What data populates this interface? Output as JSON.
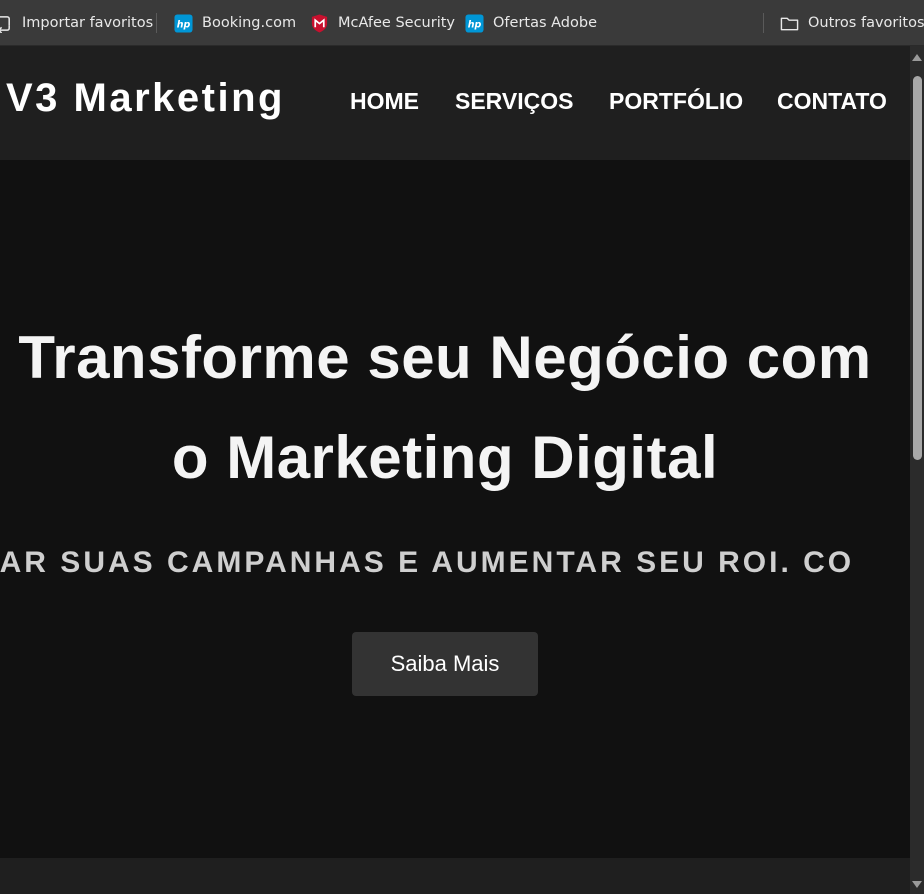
{
  "bookmarks": {
    "import": {
      "label": "Importar favoritos",
      "icon": "import-icon"
    },
    "booking": {
      "label": "Booking.com",
      "icon": "hp-icon"
    },
    "mcafee": {
      "label": "McAfee Security",
      "icon": "mcafee-icon"
    },
    "adobe": {
      "label": "Ofertas Adobe",
      "icon": "hp-icon"
    },
    "others": {
      "label": "Outros favoritos",
      "icon": "folder-icon"
    }
  },
  "site": {
    "logo": "V3 Marketing",
    "nav": {
      "home": "HOME",
      "services": "SERVIÇOS",
      "portfolio": "PORTFÓLIO",
      "contact": "CONTATO"
    },
    "hero": {
      "title_line1": "Transforme seu Negócio com",
      "title_line2": "o Marketing Digital",
      "marquee": "OTIMIZAR SUAS CAMPANHAS E AUMENTAR SEU ROI. CO",
      "cta": "Saiba Mais"
    }
  },
  "colors": {
    "header_bg": "#1f1f1f",
    "page_bg": "#111111",
    "button_bg": "#333333",
    "bookmarks_bg": "#3a3a3a",
    "mcafee_red": "#c8102e",
    "hp_blue": "#0096d6"
  }
}
